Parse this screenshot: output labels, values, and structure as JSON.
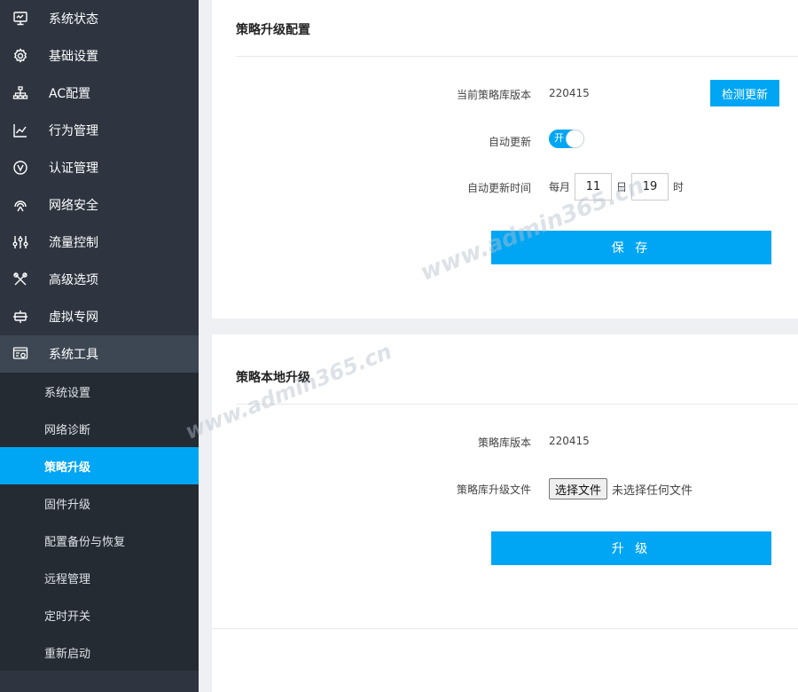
{
  "sidebar": {
    "items": [
      {
        "label": "系统状态",
        "icon": "monitor-icon"
      },
      {
        "label": "基础设置",
        "icon": "gear-icon"
      },
      {
        "label": "AC配置",
        "icon": "network-tree-icon"
      },
      {
        "label": "行为管理",
        "icon": "trend-chart-icon"
      },
      {
        "label": "认证管理",
        "icon": "verify-icon"
      },
      {
        "label": "网络安全",
        "icon": "shield-icon"
      },
      {
        "label": "流量控制",
        "icon": "sliders-icon"
      },
      {
        "label": "高级选项",
        "icon": "tools-icon"
      },
      {
        "label": "虚拟专网",
        "icon": "vpn-icon"
      },
      {
        "label": "系统工具",
        "icon": "system-tools-icon"
      }
    ],
    "submenu": [
      {
        "label": "系统设置"
      },
      {
        "label": "网络诊断"
      },
      {
        "label": "策略升级"
      },
      {
        "label": "固件升级"
      },
      {
        "label": "配置备份与恢复"
      },
      {
        "label": "远程管理"
      },
      {
        "label": "定时开关"
      },
      {
        "label": "重新启动"
      }
    ],
    "active_sub": "策略升级"
  },
  "upgrade_config": {
    "title": "策略升级配置",
    "version_label": "当前策略库版本",
    "version_value": "220415",
    "check_button": "检测更新",
    "auto_update_label": "自动更新",
    "toggle_text": "开",
    "toggle_on": true,
    "auto_time_label": "自动更新时间",
    "monthly_prefix": "每月",
    "day_value": "11",
    "day_suffix": "日",
    "hour_value": "19",
    "hour_suffix": "时",
    "save_button": "保 存"
  },
  "local_upgrade": {
    "title": "策略本地升级",
    "version_label": "策略库版本",
    "version_value": "220415",
    "file_label": "策略库升级文件",
    "file_button": "选择文件",
    "file_status": "未选择任何文件",
    "upgrade_button": "升 级"
  },
  "watermark": {
    "text_1": "www.admin365.cn",
    "text_2": "www.admin365.cn"
  },
  "colors": {
    "sidebar_bg": "#2e3540",
    "submenu_bg": "#252b33",
    "accent": "#00a6f4",
    "page_bg": "#eef0f3"
  }
}
